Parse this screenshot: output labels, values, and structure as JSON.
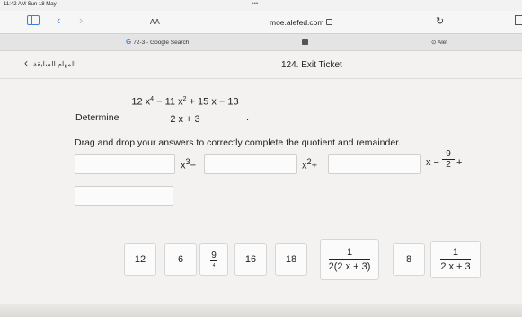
{
  "status_bar": {
    "time": "11:42 AM  Sun 18 May",
    "dots": "•••"
  },
  "browser": {
    "text_size_label": "AA",
    "url": "moe.alefed.com",
    "tabs": [
      {
        "label": "72-3 - Google Search"
      },
      {
        "label": "Alef"
      }
    ]
  },
  "app": {
    "back_label": "المهام السابقة",
    "title": "124. Exit Ticket"
  },
  "question": {
    "determine_label": "Determine",
    "numerator_parts": [
      "12 x",
      "4",
      " − 11 x",
      "2",
      " + 15 x − 13"
    ],
    "denominator": "2 x + 3",
    "period": ".",
    "instruction": "Drag and drop your answers to correctly complete the quotient and remainder."
  },
  "answer_row": {
    "term1_var": "x",
    "term1_exp": "3",
    "term1_op": "−",
    "term2_var": "x",
    "term2_exp": "2",
    "term2_op": "+",
    "term3_tail": "x −",
    "frac_num": "9",
    "frac_den": "2",
    "term4_op": "+"
  },
  "options": [
    {
      "label": "12"
    },
    {
      "label": "6"
    },
    {
      "num": "9",
      "den": "4"
    },
    {
      "label": "16"
    },
    {
      "label": "18"
    },
    {
      "num": "1",
      "den": "2(2 x + 3)"
    },
    {
      "label": "8"
    },
    {
      "num": "1",
      "den": "2 x + 3"
    }
  ]
}
